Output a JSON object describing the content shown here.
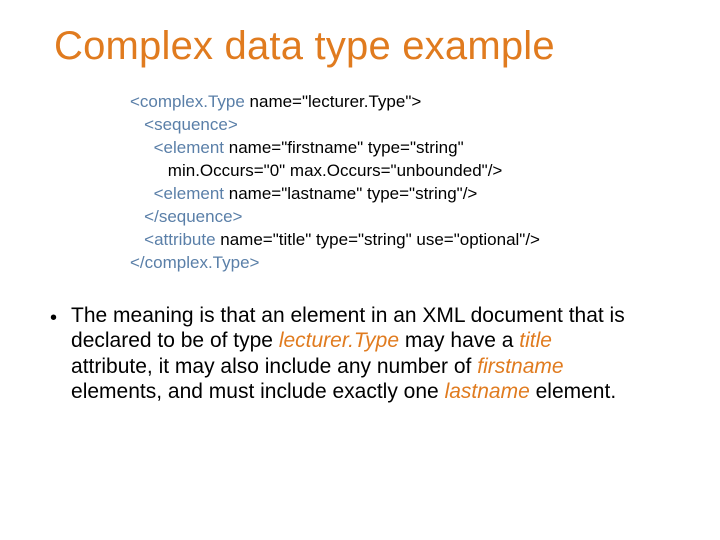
{
  "title": "Complex data type example",
  "code": {
    "l1a": "<complex.Type ",
    "l1b": "name=\"lecturer.Type\">",
    "l2": "<sequence>",
    "l3a": "<element ",
    "l3b": "name=\"firstname\" type=\"string\"",
    "l4": "min.Occurs=\"0\" max.Occurs=\"unbounded\"/>",
    "l5a": "<element ",
    "l5b": "name=\"lastname\" type=\"string\"/>",
    "l6": "</sequence>",
    "l7a": "<attribute ",
    "l7b": "name=\"title\" type=\"string\" use=\"optional\"/>",
    "l8": "</complex.Type>"
  },
  "bullet": {
    "t1": "The meaning is that an element in an XML document that is declared to be of type ",
    "em1": "lecturer.Type",
    "t2": " may have a ",
    "em2": "title",
    "t3": " attribute, it may also include any number of ",
    "em3": "firstname",
    "t4": " elements, and must include exactly one ",
    "em4": "lastname",
    "t5": " element."
  },
  "dot": "•"
}
